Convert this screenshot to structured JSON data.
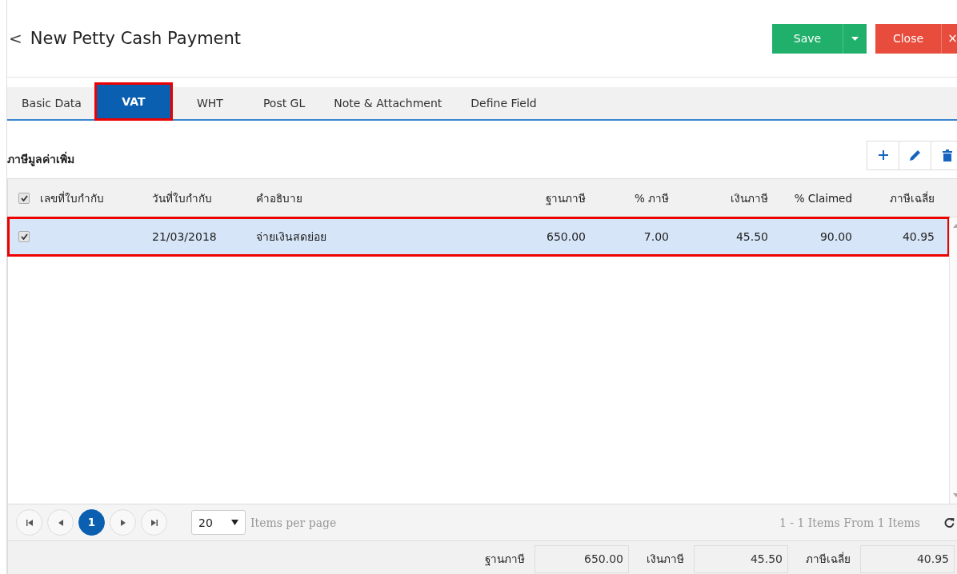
{
  "header": {
    "back": "<",
    "title": "New Petty Cash Payment",
    "save": "Save",
    "close": "Close",
    "close_x": "×"
  },
  "tabs": [
    {
      "label": "Basic Data",
      "selected": false,
      "highlighted": false
    },
    {
      "label": "VAT",
      "selected": true,
      "highlighted": true
    },
    {
      "label": "WHT",
      "selected": false,
      "highlighted": false
    },
    {
      "label": "Post GL",
      "selected": false,
      "highlighted": false
    },
    {
      "label": "Note & Attachment",
      "selected": false,
      "highlighted": false
    },
    {
      "label": "Define Field",
      "selected": false,
      "highlighted": false
    }
  ],
  "section_title": "ภาษีมูลค่าเพิ่ม",
  "table": {
    "all_checked": true,
    "columns": [
      "เลขที่ใบกำกับ",
      "วันที่ใบกำกับ",
      "คำอธิบาย",
      "ฐานภาษี",
      "% ภาษี",
      "เงินภาษี",
      "% Claimed",
      "ภาษีเฉลี่ย"
    ],
    "rows": [
      {
        "checked": true,
        "selected": true,
        "highlighted": true,
        "cells": [
          "",
          "21/03/2018",
          "จ่ายเงินสดย่อย",
          "650.00",
          "7.00",
          "45.50",
          "90.00",
          "40.95"
        ]
      }
    ]
  },
  "pager": {
    "pages": [
      {
        "label": "1",
        "selected": true
      }
    ],
    "page_size": "20",
    "per_page_label": "Items per page",
    "summary": "1 - 1 Items From 1 Items"
  },
  "totals": [
    {
      "label": "ฐานภาษี",
      "value": "650.00"
    },
    {
      "label": "เงินภาษี",
      "value": "45.50"
    },
    {
      "label": "ภาษีเฉลี่ย",
      "value": "40.95"
    }
  ]
}
